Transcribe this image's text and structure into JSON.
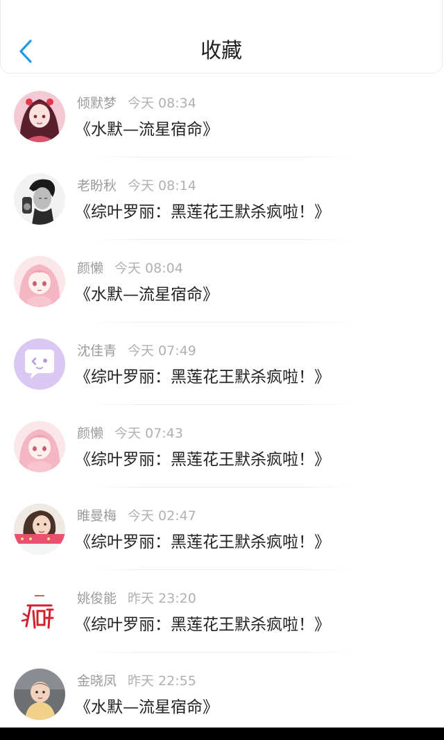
{
  "header": {
    "back_icon": "chevron-left-icon",
    "title": "收藏"
  },
  "colors": {
    "accent": "#1e9be6",
    "text_primary": "#222222",
    "text_secondary": "#9b9b9b",
    "divider": "#ececec"
  },
  "favorites": [
    {
      "author": "倾默梦",
      "time": "今天 08:34",
      "title": "《水默—流星宿命》",
      "avatar": "anime-girl-red-avatar"
    },
    {
      "author": "老盼秋",
      "time": "今天 08:14",
      "title": "《综叶罗丽：黑莲花王默杀疯啦！》",
      "avatar": "man-bw-avatar"
    },
    {
      "author": "颜懒",
      "time": "今天 08:04",
      "title": "《水默—流星宿命》",
      "avatar": "anime-girl-pink-avatar"
    },
    {
      "author": "沈佳青",
      "time": "今天 07:49",
      "title": "《综叶罗丽：黑莲花王默杀疯啦！》",
      "avatar": "chat-bubble-purple-avatar"
    },
    {
      "author": "颜懒",
      "time": "今天 07:43",
      "title": "《综叶罗丽：黑莲花王默杀疯啦！》",
      "avatar": "anime-girl-pink-avatar"
    },
    {
      "author": "睢曼梅",
      "time": "今天 02:47",
      "title": "《综叶罗丽：黑莲花王默杀疯啦！》",
      "avatar": "woman-photo-avatar"
    },
    {
      "author": "姚俊能",
      "time": "昨天 23:20",
      "title": "《综叶罗丽：黑莲花王默杀疯啦！》",
      "avatar": "red-calligraphy-avatar"
    },
    {
      "author": "金晓凤",
      "time": "昨天 22:55",
      "title": "《水默—流星宿命》",
      "avatar": "baby-photo-avatar"
    }
  ]
}
